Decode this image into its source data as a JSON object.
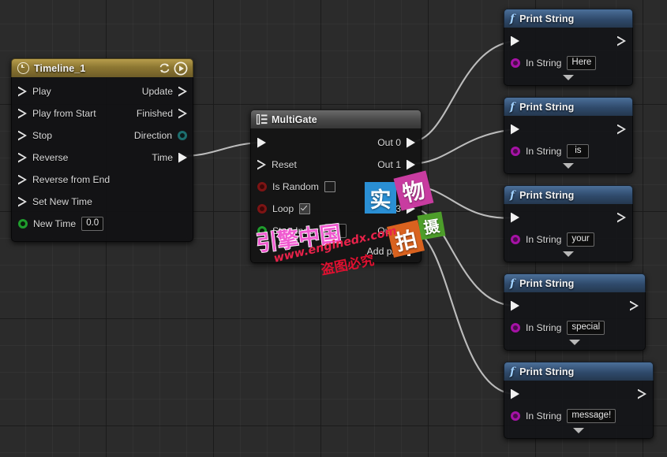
{
  "editor": {
    "name": "unreal-blueprint-graph",
    "background_color": "#2b2b2b",
    "grid": "on"
  },
  "timeline_node": {
    "title": "Timeline_1",
    "icon": "clock-icon",
    "header_color": "#8d7732",
    "header_buttons": [
      {
        "name": "loop-icon",
        "label": "Loop"
      },
      {
        "name": "play-icon",
        "label": "Play"
      }
    ],
    "inputs": [
      {
        "label": "Play",
        "pin": "exec"
      },
      {
        "label": "Play from Start",
        "pin": "exec"
      },
      {
        "label": "Stop",
        "pin": "exec"
      },
      {
        "label": "Reverse",
        "pin": "exec"
      },
      {
        "label": "Reverse from End",
        "pin": "exec"
      },
      {
        "label": "Set New Time",
        "pin": "exec"
      }
    ],
    "outputs": [
      {
        "label": "Update",
        "pin": "exec"
      },
      {
        "label": "Finished",
        "pin": "exec"
      },
      {
        "label": "Direction",
        "pin": "enum",
        "color": "#1c6e6e"
      },
      {
        "label": "Time",
        "pin": "float"
      }
    ],
    "new_time": {
      "label": "New Time",
      "value": "0.0",
      "pin_color": "#1f9c2d"
    }
  },
  "multigate_node": {
    "title": "MultiGate",
    "icon": "multigate-icon",
    "header_color": "#4a4a4a",
    "inputs": [
      {
        "label": "",
        "pin": "exec"
      },
      {
        "label": "Reset",
        "pin": "exec"
      },
      {
        "label": "Is Random",
        "pin": "bool",
        "checked": false
      },
      {
        "label": "Loop",
        "pin": "bool",
        "checked": true
      },
      {
        "label": "Start Index",
        "pin": "int",
        "value": "-1"
      }
    ],
    "outputs": [
      {
        "label": "Out 0"
      },
      {
        "label": "Out 1"
      },
      {
        "label": "Out 2"
      },
      {
        "label": "Out 3"
      },
      {
        "label": "Out 4"
      }
    ],
    "add_pin_label": "Add pin"
  },
  "print_nodes": [
    {
      "title": "Print String",
      "in_string_label": "In String",
      "value": "Here"
    },
    {
      "title": "Print String",
      "in_string_label": "In String",
      "value": "is"
    },
    {
      "title": "Print String",
      "in_string_label": "In String",
      "value": "your"
    },
    {
      "title": "Print String",
      "in_string_label": "In String",
      "value": "special"
    },
    {
      "title": "Print String",
      "in_string_label": "In String",
      "value": "message!"
    }
  ],
  "watermark": {
    "squares": [
      {
        "char": "实",
        "color": "#2a8fd4"
      },
      {
        "char": "物",
        "color": "#c83ca0"
      },
      {
        "char": "拍",
        "color": "#d9621f"
      },
      {
        "char": "摄",
        "color": "#4d9e2a"
      }
    ],
    "brand": "引擎中国",
    "url": "www.enginedx.com",
    "warning": "盗图必究"
  }
}
